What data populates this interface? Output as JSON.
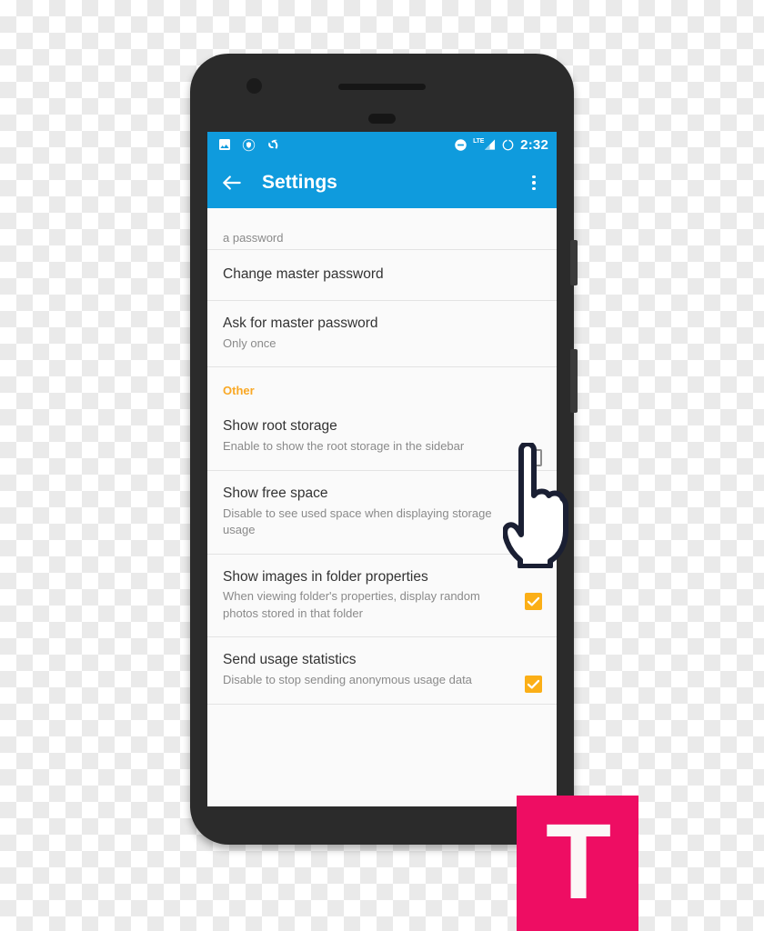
{
  "device": {
    "frame_color": "#2b2b2b",
    "parts": {
      "camera": "camera-dot",
      "speaker": "speaker-grille",
      "sensor": "sensor-pill",
      "volume_button": "side-button",
      "power_button": "side-button"
    }
  },
  "status_bar": {
    "background": "#0f9bdd",
    "time": "2:32",
    "left_icons": [
      {
        "name": "image-icon",
        "glyph": "photo"
      },
      {
        "name": "shield-icon",
        "glyph": "shield"
      },
      {
        "name": "phone-call-icon",
        "glyph": "call"
      }
    ],
    "right_icons": [
      {
        "name": "do-not-disturb-icon",
        "glyph": "minus-circle"
      },
      {
        "name": "lte-signal-icon",
        "label": "LTE"
      },
      {
        "name": "battery-circle-icon",
        "glyph": "circle"
      }
    ]
  },
  "app_bar": {
    "background": "#0f9bdd",
    "back_icon": "back-arrow-icon",
    "title": "Settings",
    "overflow_icon": "overflow-menu-icon"
  },
  "theme": {
    "accent": "#0f9bdd",
    "section_header_color": "#f9a825",
    "checkbox_checked_color": "#fbaf17",
    "checkbox_unchecked_border": "#8d8d8d",
    "list_background": "#fafafa",
    "title_color": "#333333",
    "subtitle_color": "#8a8a8a",
    "divider_color": "#e3e3e3",
    "badge_pink": "#ee0d63"
  },
  "settings_list": {
    "clipped_top_row": {
      "title": "a password",
      "note": "partially scrolled out of view"
    },
    "rows": [
      {
        "name": "change-master-password",
        "title": "Change master password",
        "subtitle": "",
        "has_checkbox": false
      },
      {
        "name": "ask-for-master-password",
        "title": "Ask for master password",
        "subtitle": "Only once",
        "has_checkbox": false
      }
    ],
    "section": {
      "header": "Other",
      "rows": [
        {
          "name": "show-root-storage",
          "title": "Show root storage",
          "subtitle": "Enable to show the root storage in the sidebar",
          "has_checkbox": true,
          "checked": false
        },
        {
          "name": "show-free-space",
          "title": "Show free space",
          "subtitle": "Disable to see used space when displaying storage usage",
          "has_checkbox": true,
          "checked": true
        },
        {
          "name": "show-images-in-folder-properties",
          "title": "Show images in folder properties",
          "subtitle": "When viewing folder's properties, display random photos stored in that folder",
          "has_checkbox": true,
          "checked": true
        },
        {
          "name": "send-usage-statistics",
          "title": "Send usage statistics",
          "subtitle": "Disable to stop sending anonymous usage data",
          "has_checkbox": true,
          "checked": true
        }
      ]
    }
  },
  "overlays": {
    "hand_cursor": {
      "name": "pointing-hand-cursor",
      "outline_color": "#1a1f33",
      "fill_color": "#ffffff"
    },
    "badge": {
      "name": "brand-badge",
      "letter": "T",
      "background": "#ee0d63",
      "letter_color": "#fbf7f7"
    }
  }
}
